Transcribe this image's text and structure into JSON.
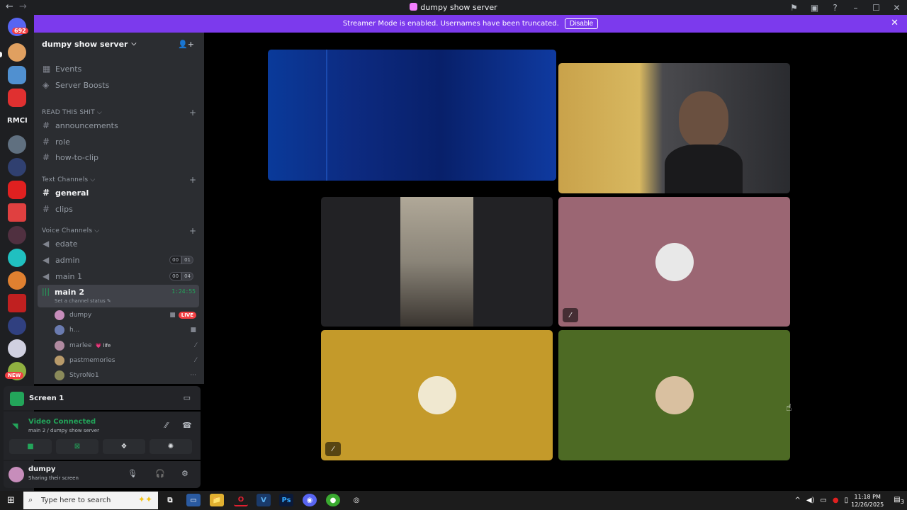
{
  "window": {
    "title": "dumpy show server",
    "back_icon": "←",
    "fwd_icon": "→",
    "controls": [
      "⚑",
      "▣",
      "?",
      "–",
      "☐",
      "✕"
    ]
  },
  "server_rail": {
    "mention_count": "692",
    "rmci_label": "RMCI",
    "new_badge": "NEW"
  },
  "banner": {
    "text": "Streamer Mode is enabled. Usernames have been truncated.",
    "button": "Disable",
    "close": "✕",
    "color": "#7c3aed"
  },
  "server": {
    "name": "dumpy show server",
    "chevron": "⌵",
    "invite_icon": "👤+"
  },
  "top_items": [
    {
      "icon": "▦",
      "label": "Events"
    },
    {
      "icon": "◈",
      "label": "Server Boosts"
    }
  ],
  "categories": {
    "read": "READ THIS SHIT",
    "text": "Text Channels",
    "voice": "Voice Channels"
  },
  "read_channels": [
    "announcements",
    "role",
    "how-to-clip"
  ],
  "text_channels": [
    "general",
    "clips"
  ],
  "voice_channels": [
    {
      "name": "edate",
      "a": "",
      "b": ""
    },
    {
      "name": "admin",
      "a": "00",
      "b": "01"
    },
    {
      "name": "main 1",
      "a": "00",
      "b": "04"
    }
  ],
  "active_voice": {
    "name": "main 2",
    "timer": "1:24:55",
    "status": "Set a channel status ✎"
  },
  "voice_users": [
    {
      "name": "dumpy",
      "color": "#c78dbb",
      "right": "■",
      "live": "LIVE"
    },
    {
      "name": "h...",
      "color": "#6a7bb0",
      "right": "■"
    },
    {
      "name": "marlee",
      "color": "#b08aa0",
      "right": "⁄",
      "tag": "💗 life"
    },
    {
      "name": "pastmemories",
      "color": "#b89a6a",
      "right": "⁄"
    },
    {
      "name": "StyroNo1",
      "color": "#8a8a5a",
      "right": "···"
    }
  ],
  "screen_panel": {
    "title": "Screen 1",
    "icon": "▭"
  },
  "voice_connection": {
    "status": "Video Connected",
    "location": "main 2 / dumpy show server",
    "buttons": [
      "■",
      "⊠",
      "❖",
      "✺"
    ]
  },
  "user": {
    "name": "dumpy",
    "status": "Sharing their screen",
    "mic": "🎙",
    "headset": "🎧",
    "gear": "⚙"
  },
  "tiles": [
    {
      "bg": "#0a2a8a",
      "muted": false
    },
    {
      "bg": "#3a3b3f",
      "muted": false
    },
    {
      "bg": "#222225",
      "muted": false
    },
    {
      "bg": "#9b6673",
      "muted": true,
      "avatar": "#e8e8e8"
    },
    {
      "bg": "#c49a2a",
      "muted": true,
      "avatar": "#f0e8d0"
    },
    {
      "bg": "#4d6a24",
      "muted": false,
      "avatar": "#d9c0a0"
    }
  ],
  "taskbar": {
    "search_placeholder": "Type here to search",
    "time": "11:18 PM",
    "date": "12/26/2025",
    "apps": [
      "▭",
      "📁",
      "O",
      "V",
      "Ps",
      "◉",
      "●",
      "◎"
    ],
    "notif_count": "3"
  }
}
